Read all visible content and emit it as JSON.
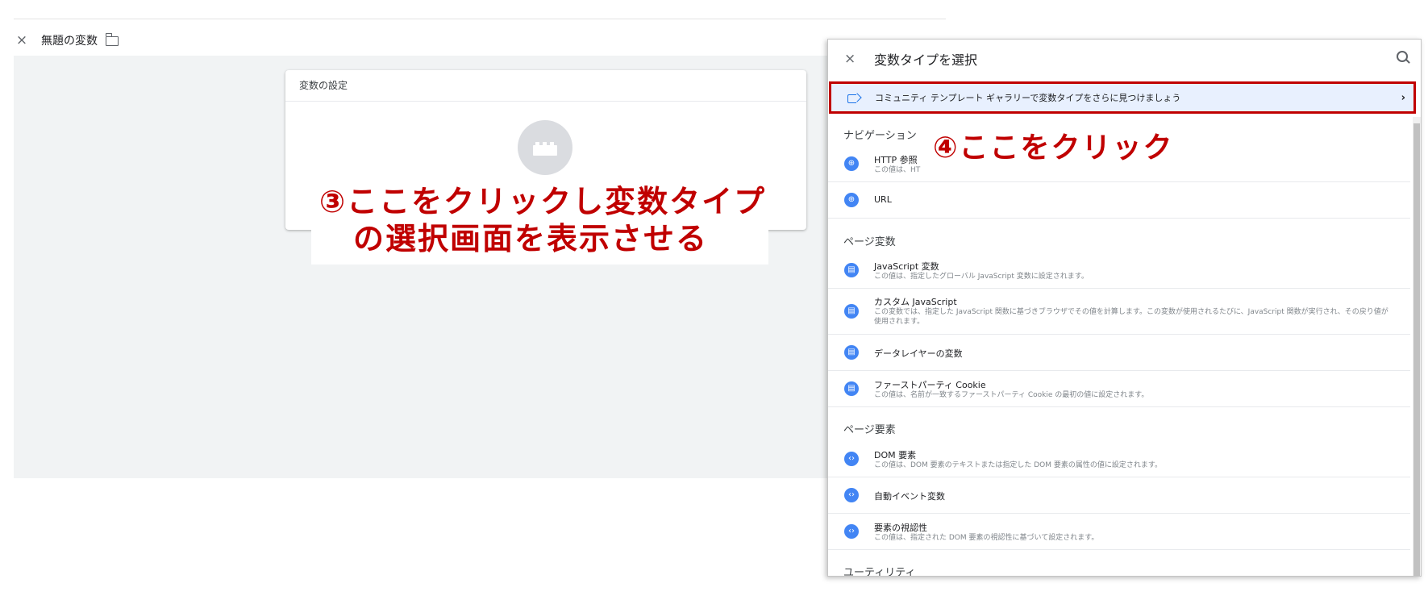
{
  "editor": {
    "close": "×",
    "title": "無題の変数",
    "card_title": "変数の設定"
  },
  "annotations": {
    "step3_line1": "③ここをクリックし変数タイプ",
    "step3_line2": "の選択画面を表示させる",
    "step4": "④ここをクリック"
  },
  "panel": {
    "close": "×",
    "title": "変数タイプを選択",
    "community_label": "コミュニティ テンプレート ギャラリーで変数タイプをさらに見つけましょう",
    "community_chevron": "›",
    "sections": [
      {
        "title": "ナビゲーション",
        "items": [
          {
            "name": "HTTP 参照",
            "desc": "この値は、HT",
            "icon": "globe-icon"
          },
          {
            "name": "URL",
            "desc": "",
            "icon": "globe-icon"
          }
        ]
      },
      {
        "title": "ページ変数",
        "items": [
          {
            "name": "JavaScript 変数",
            "desc": "この値は、指定したグローバル JavaScript 変数に設定されます。",
            "icon": "document-icon"
          },
          {
            "name": "カスタム JavaScript",
            "desc": "この変数では、指定した JavaScript 関数に基づきブラウザでその値を計算します。この変数が使用されるたびに、JavaScript 関数が実行され、その戻り値が使用されます。",
            "icon": "document-icon"
          },
          {
            "name": "データレイヤーの変数",
            "desc": "",
            "icon": "document-icon"
          },
          {
            "name": "ファーストパーティ Cookie",
            "desc": "この値は、名前が一致するファーストパーティ Cookie の最初の値に設定されます。",
            "icon": "document-icon"
          }
        ]
      },
      {
        "title": "ページ要素",
        "items": [
          {
            "name": "DOM 要素",
            "desc": "この値は、DOM 要素のテキストまたは指定した DOM 要素の属性の値に設定されます。",
            "icon": "code-icon"
          },
          {
            "name": "自動イベント変数",
            "desc": "",
            "icon": "code-icon"
          },
          {
            "name": "要素の視認性",
            "desc": "この値は、指定された DOM 要素の視認性に基づいて設定されます。",
            "icon": "code-icon"
          }
        ]
      },
      {
        "title": "ユーティリティ",
        "items": []
      }
    ]
  },
  "colors": {
    "annotation_red": "#c00000",
    "icon_blue": "#4285f4",
    "highlight_bg": "#e8f0fe"
  }
}
